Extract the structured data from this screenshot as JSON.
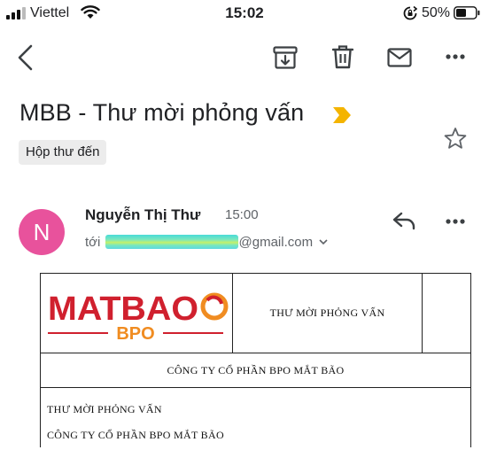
{
  "status_bar": {
    "carrier": "Viettel",
    "time": "15:02",
    "battery": "50%"
  },
  "toolbar": {
    "back_icon": "back-chevron-icon",
    "archive_icon": "archive-icon",
    "delete_icon": "trash-icon",
    "mark_unread_icon": "mail-icon",
    "more_icon": "more-horizontal-icon"
  },
  "email": {
    "subject": "MBB - Thư mời phỏng vấn",
    "label": "Hộp thư đến",
    "sender": {
      "initial": "N",
      "name": "Nguyễn Thị Thư",
      "time": "15:00",
      "to_prefix": "tới",
      "to_suffix": "@gmail.com"
    }
  },
  "letter": {
    "logo_text": "MATBAO",
    "logo_sub": "BPO",
    "header_title": "THƯ MỜI PHỎNG VẤN",
    "company_row": "CÔNG TY CỔ PHẦN BPO MẮT BÃO",
    "body_lines": [
      "THƯ MỜI PHỎNG VẤN",
      "CÔNG TY CỔ PHẦN BPO MẮT BÃO"
    ]
  },
  "colors": {
    "avatar": "#e8529c",
    "logo_red": "#d0202e",
    "logo_orange": "#f08c21",
    "important_marker": "#f4b400"
  }
}
